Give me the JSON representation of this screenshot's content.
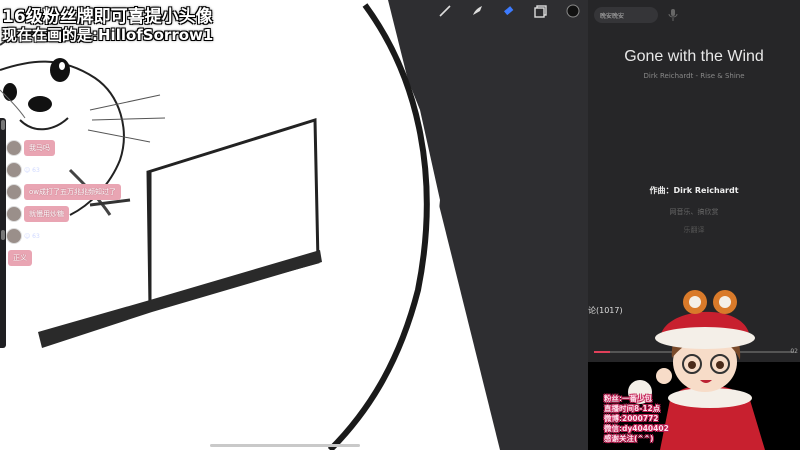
{
  "overlay": {
    "line1": "16级粉丝牌即可喜提小头像",
    "line2": "现在在画的是:HillofSorrow1"
  },
  "toolbar": {
    "tools": [
      "brush-icon",
      "smudge-icon",
      "eraser-icon",
      "layers-icon",
      "color-swatch"
    ],
    "active_color": "#111111"
  },
  "chat": {
    "messages": [
      {
        "text": "我马吗",
        "meta": ""
      },
      {
        "text": "",
        "meta": "☺ 63"
      },
      {
        "text": "ow成打了五万兆兆频知过了",
        "meta": ""
      },
      {
        "text": "就慢用炒糖",
        "meta": ""
      },
      {
        "text": "",
        "meta": "☺ 63"
      },
      {
        "text": "正义",
        "meta": ""
      }
    ]
  },
  "music": {
    "search_placeholder": "晚安晚安",
    "song_title": "Gone with the Wind",
    "song_artist": "Dirk Reichardt - Rise & Shine",
    "lyrics": [
      "作曲：Dirk Reichardt",
      "网音乐、搞欣赏",
      "乐翻译"
    ],
    "comments_label": "论(1017)",
    "time_left": "",
    "time_right": "02",
    "progress": 0.08,
    "accent_color": "#e0405a"
  },
  "mascot_notice": {
    "lines": [
      "粉丝:一番少包",
      "直播时间8-12点",
      "微博:2000772",
      "微信:dy4040402",
      "感谢关注(^^)"
    ]
  }
}
